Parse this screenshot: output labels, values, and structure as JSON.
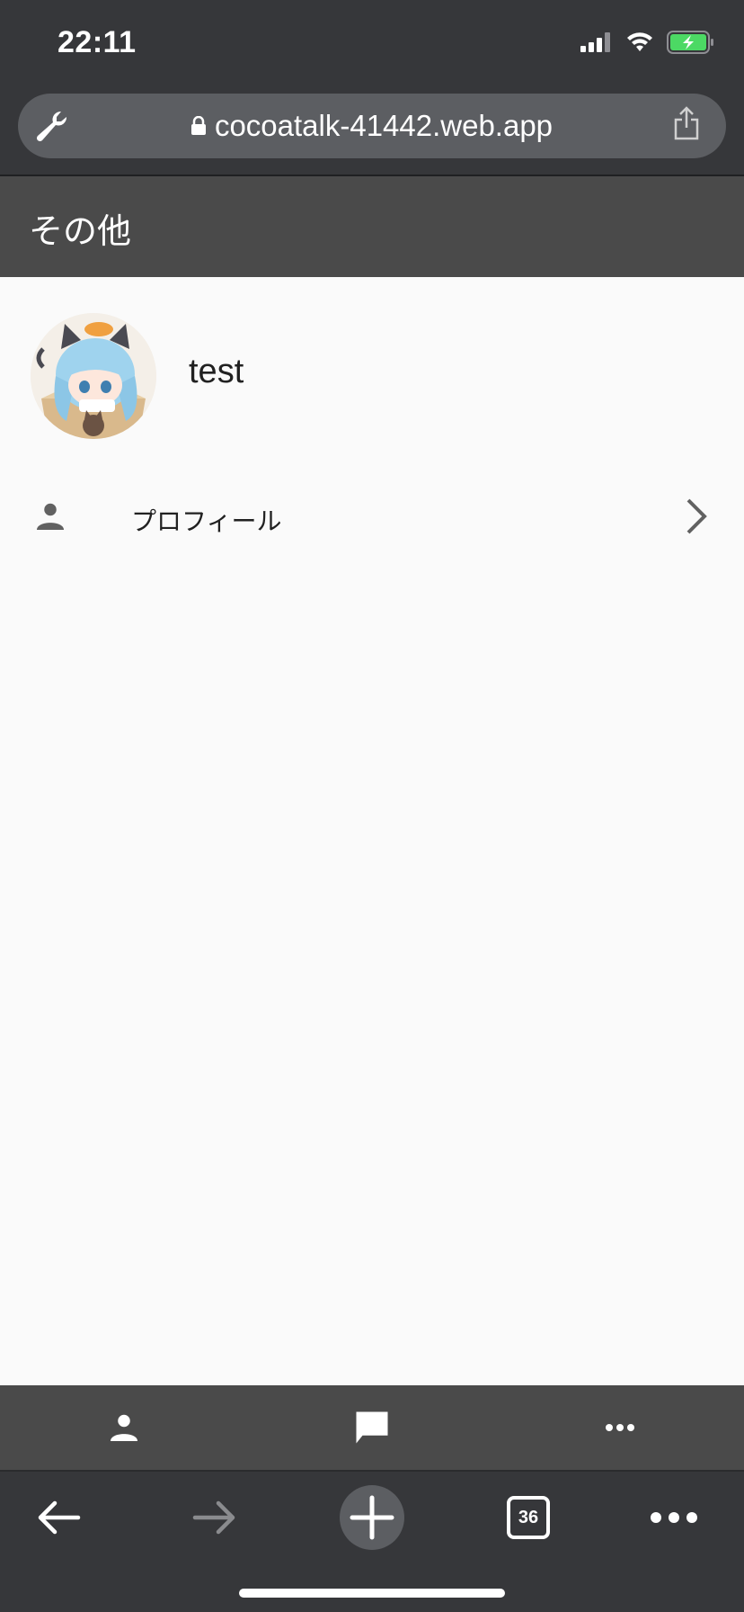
{
  "status_bar": {
    "time": "22:11",
    "icons": [
      "cellular-signal-icon",
      "wifi-icon",
      "battery-charging-icon"
    ]
  },
  "browser": {
    "url": "cocoatalk-41442.web.app",
    "tabs_count": "36",
    "icons": [
      "wrench-icon",
      "lock-icon",
      "share-icon",
      "back-arrow-icon",
      "forward-arrow-icon",
      "new-tab-plus-icon",
      "tabs-icon",
      "more-dots-icon"
    ]
  },
  "app": {
    "title": "その他",
    "user": {
      "name": "test"
    },
    "menu": [
      {
        "label": "プロフィール",
        "icon": "person-icon"
      }
    ],
    "bottom_nav": [
      {
        "icon": "person-icon"
      },
      {
        "icon": "chat-bubble-icon"
      },
      {
        "icon": "more-horizontal-icon"
      }
    ]
  },
  "colors": {
    "browser_chrome": "#36373a",
    "url_bar": "#5c5e62",
    "app_bar": "#4a4a4a",
    "background": "#fafafa",
    "battery": "#4cd964"
  }
}
